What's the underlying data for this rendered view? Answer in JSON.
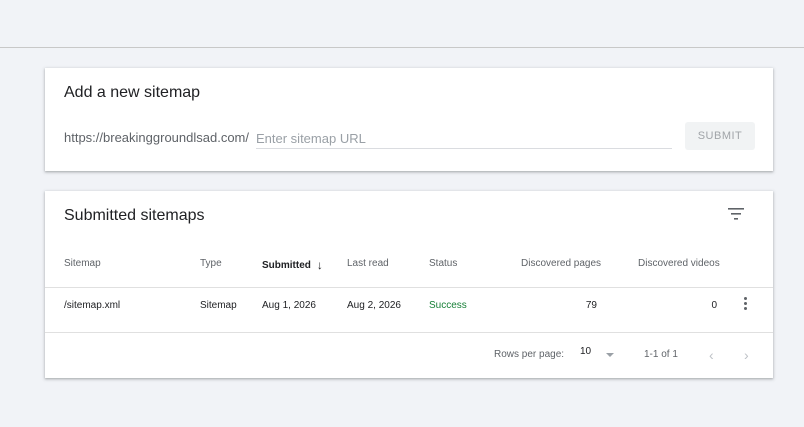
{
  "add_sitemap": {
    "title": "Add a new sitemap",
    "prefix": "https://breakinggroundlsad.com/",
    "placeholder": "Enter sitemap URL",
    "submit_label": "SUBMIT"
  },
  "submitted": {
    "title": "Submitted sitemaps",
    "columns": [
      "Sitemap",
      "Type",
      "Submitted",
      "Last read",
      "Status",
      "Discovered pages",
      "Discovered videos"
    ],
    "sort_arrow": "↓",
    "rows": [
      {
        "sitemap": "/sitemap.xml",
        "type": "Sitemap",
        "submitted": "Aug 1, 2026",
        "last_read": "Aug 2, 2026",
        "status": "Success",
        "pages": "79",
        "videos": "0"
      }
    ],
    "footer": {
      "rows_per_page_label": "Rows per page:",
      "rows_per_page_value": "10",
      "range": "1-1 of 1",
      "prev": "‹",
      "next": "›"
    }
  },
  "icons": {
    "filter": "filter-icon",
    "more": "more-vert-icon"
  },
  "colors": {
    "success": "#188038",
    "background": "#f1f3f7"
  }
}
